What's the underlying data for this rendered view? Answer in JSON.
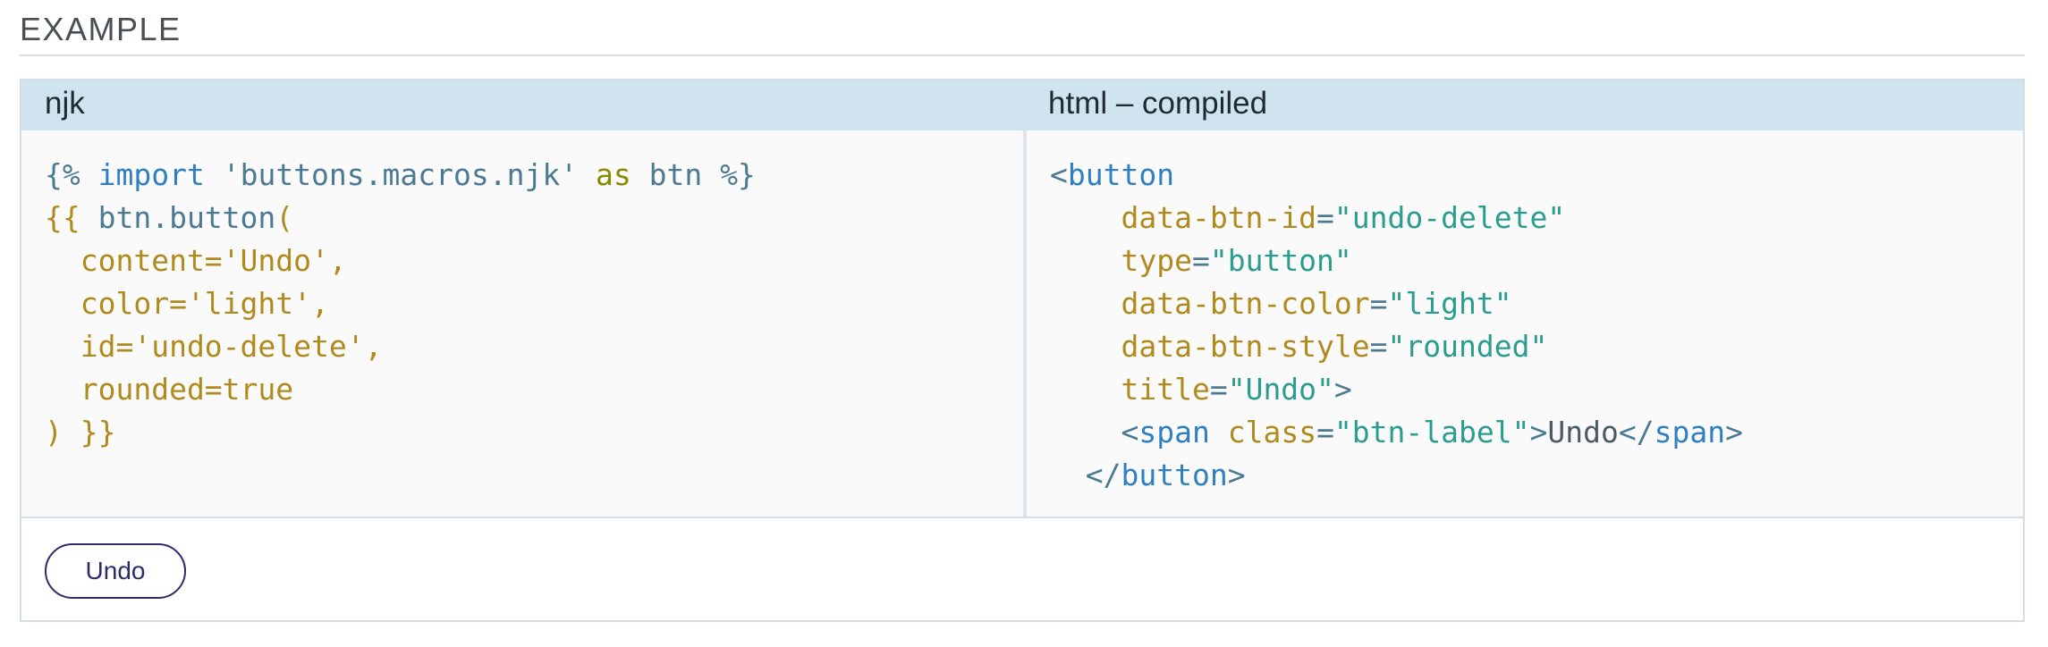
{
  "section": {
    "title": "EXAMPLE"
  },
  "example": {
    "left_label": "njk",
    "right_label": "html – compiled",
    "njk_lines": [
      [
        [
          "tk-delim",
          "{%"
        ],
        [
          "tk-text",
          " "
        ],
        [
          "tk-kw",
          "import"
        ],
        [
          "tk-text",
          " "
        ],
        [
          "tk-str",
          "'buttons.macros.njk'"
        ],
        [
          "tk-text",
          " "
        ],
        [
          "tk-as",
          "as"
        ],
        [
          "tk-text",
          " "
        ],
        [
          "tk-var",
          "btn"
        ],
        [
          "tk-text",
          " "
        ],
        [
          "tk-delim",
          "%}"
        ]
      ],
      [
        [
          "tk-y",
          "{{ "
        ],
        [
          "tk-var",
          "btn.button"
        ],
        [
          "tk-y",
          "("
        ]
      ],
      [
        [
          "tk-y",
          "  content='Undo',"
        ]
      ],
      [
        [
          "tk-y",
          "  color='light',"
        ]
      ],
      [
        [
          "tk-y",
          "  id='undo-delete',"
        ]
      ],
      [
        [
          "tk-y",
          "  rounded=true"
        ]
      ],
      [
        [
          "tk-y",
          ") }}"
        ]
      ]
    ],
    "html_lines": [
      [
        [
          "tk-punct",
          "<"
        ],
        [
          "tk-tag",
          "button"
        ]
      ],
      [
        [
          "tk-text",
          "    "
        ],
        [
          "tk-attr",
          "data-btn-id"
        ],
        [
          "tk-eq",
          "="
        ],
        [
          "tk-val",
          "\"undo-delete\""
        ]
      ],
      [
        [
          "tk-text",
          "    "
        ],
        [
          "tk-attr",
          "type"
        ],
        [
          "tk-eq",
          "="
        ],
        [
          "tk-val",
          "\"button\""
        ]
      ],
      [
        [
          "tk-text",
          "    "
        ],
        [
          "tk-attr",
          "data-btn-color"
        ],
        [
          "tk-eq",
          "="
        ],
        [
          "tk-val",
          "\"light\""
        ]
      ],
      [
        [
          "tk-text",
          "    "
        ],
        [
          "tk-attr",
          "data-btn-style"
        ],
        [
          "tk-eq",
          "="
        ],
        [
          "tk-val",
          "\"rounded\""
        ]
      ],
      [
        [
          "tk-text",
          "    "
        ],
        [
          "tk-attr",
          "title"
        ],
        [
          "tk-eq",
          "="
        ],
        [
          "tk-val",
          "\"Undo\""
        ],
        [
          "tk-punct",
          ">"
        ]
      ],
      [
        [
          "tk-text",
          "    "
        ],
        [
          "tk-punct",
          "<"
        ],
        [
          "tk-tag",
          "span"
        ],
        [
          "tk-text",
          " "
        ],
        [
          "tk-attr",
          "class"
        ],
        [
          "tk-eq",
          "="
        ],
        [
          "tk-val",
          "\"btn-label\""
        ],
        [
          "tk-punct",
          ">"
        ],
        [
          "tk-text",
          "Undo"
        ],
        [
          "tk-punct",
          "</"
        ],
        [
          "tk-tag",
          "span"
        ],
        [
          "tk-punct",
          ">"
        ]
      ],
      [
        [
          "tk-text",
          "  "
        ],
        [
          "tk-punct",
          "</"
        ],
        [
          "tk-tag",
          "button"
        ],
        [
          "tk-punct",
          ">"
        ]
      ]
    ],
    "demo_button_label": "Undo"
  }
}
